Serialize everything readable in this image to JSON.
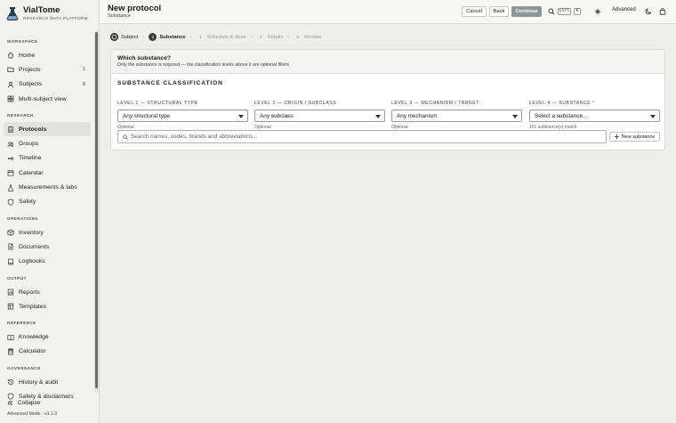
{
  "app": {
    "name": "VialTome",
    "tagline": "RESEARCH DATA PLATFORM"
  },
  "sidebar": {
    "sections": [
      {
        "title": "WORKSPACE",
        "items": [
          {
            "label": "Home",
            "icon": "home-icon"
          },
          {
            "label": "Projects",
            "icon": "folder-icon",
            "count": "1"
          },
          {
            "label": "Subjects",
            "icon": "user-icon",
            "count": "8"
          },
          {
            "label": "Multi-subject view",
            "icon": "grid-icon"
          }
        ]
      },
      {
        "title": "RESEARCH",
        "items": [
          {
            "label": "Protocols",
            "icon": "clipboard-icon",
            "active": true
          },
          {
            "label": "Groups",
            "icon": "users-icon"
          },
          {
            "label": "Timeline",
            "icon": "timeline-icon"
          },
          {
            "label": "Calendar",
            "icon": "calendar-icon"
          },
          {
            "label": "Measurements & labs",
            "icon": "flask-icon"
          },
          {
            "label": "Safety",
            "icon": "shield-icon"
          }
        ]
      },
      {
        "title": "OPERATIONS",
        "items": [
          {
            "label": "Inventory",
            "icon": "box-icon"
          },
          {
            "label": "Documents",
            "icon": "document-icon"
          },
          {
            "label": "Logbooks",
            "icon": "book-icon"
          }
        ]
      },
      {
        "title": "OUTPUT",
        "items": [
          {
            "label": "Reports",
            "icon": "report-icon"
          },
          {
            "label": "Templates",
            "icon": "template-icon"
          }
        ]
      },
      {
        "title": "REFERENCE",
        "items": [
          {
            "label": "Knowledge",
            "icon": "book-open-icon"
          },
          {
            "label": "Calculator",
            "icon": "calculator-icon"
          }
        ]
      },
      {
        "title": "GOVERNANCE",
        "items": [
          {
            "label": "History & audit",
            "icon": "history-icon"
          },
          {
            "label": "Safety & disclaimers",
            "icon": "shield-icon"
          }
        ]
      }
    ],
    "collapse_label": "Collapse",
    "mode_label": "Advanced Mode · v1.1.0"
  },
  "header": {
    "title": "New protocol",
    "subtitle": "Substance",
    "cancel_label": "Cancel",
    "back_label": "Back",
    "continue_label": "Continue",
    "shortcut_ctrl": "Ctrl",
    "shortcut_key": "K",
    "advanced_label": "Advanced"
  },
  "steps": [
    {
      "num": "✓",
      "label": "Subject",
      "state": "done"
    },
    {
      "num": "2",
      "label": "Substance",
      "state": "current"
    },
    {
      "num": "3",
      "label": "Schedule & dose",
      "state": "todo"
    },
    {
      "num": "4",
      "label": "Details",
      "state": "todo"
    },
    {
      "num": "5",
      "label": "Review",
      "state": "todo"
    }
  ],
  "card": {
    "question": "Which substance?",
    "help": "Only the substance is required — the classification levels above it are optional filters",
    "section_title": "SUBSTANCE CLASSIFICATION",
    "levels": [
      {
        "label": "LEVEL 1 — STRUCTURAL TYPE",
        "required": "",
        "value": "Any structural type",
        "note": "Optional"
      },
      {
        "label": "LEVEL 2 — ORIGIN / SUBCLASS",
        "required": "",
        "value": "Any subclass",
        "note": "Optional"
      },
      {
        "label": "LEVEL 3 — MECHANISM / TARGET",
        "required": "",
        "value": "Any mechanism",
        "note": "Optional"
      },
      {
        "label": "LEVEL 4 — SUBSTANCE",
        "required": "*",
        "value": "Select a substance...",
        "note": "101 substance(s) match"
      }
    ],
    "search_placeholder": "Search names, codes, brands and abbreviations...",
    "new_substance_label": "New substance"
  },
  "colors": {
    "primary_button": "#8f9695",
    "active_nav": "#e2e2e0",
    "step_active": "#3a3a3a"
  }
}
